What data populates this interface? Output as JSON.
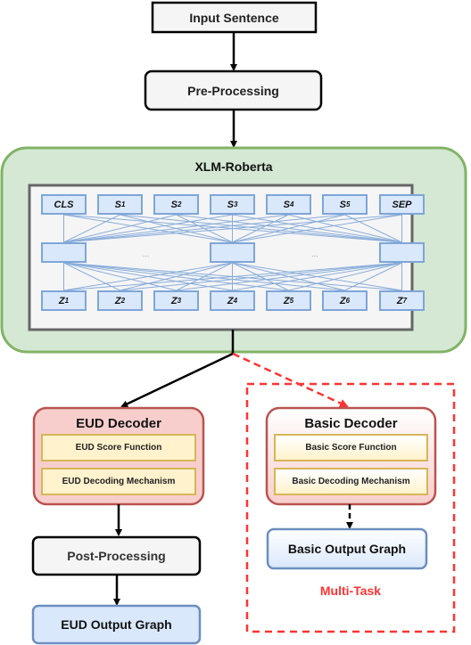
{
  "nodes": {
    "input": "Input Sentence",
    "preprocessing": "Pre-Processing",
    "encoder": "XLM-Roberta",
    "eud_decoder": {
      "title": "EUD Decoder",
      "components": [
        "EUD Score Function",
        "EUD Decoding Mechanism"
      ]
    },
    "basic_decoder": {
      "title": "Basic Decoder",
      "components": [
        "Basic Score Function",
        "Basic Decoding Mechanism"
      ]
    },
    "postprocessing": "Post-Processing",
    "eud_output": "EUD Output Graph",
    "basic_output": "Basic Output Graph",
    "multitask_label": "Multi-Task"
  },
  "tokens_in": [
    {
      "base": "CLS",
      "sub": ""
    },
    {
      "base": "S",
      "sub": "1"
    },
    {
      "base": "S",
      "sub": "2"
    },
    {
      "base": "S",
      "sub": "3"
    },
    {
      "base": "S",
      "sub": "4"
    },
    {
      "base": "S",
      "sub": "5"
    },
    {
      "base": "SEP",
      "sub": ""
    }
  ],
  "tokens_out": [
    {
      "base": "Z",
      "sub": "1"
    },
    {
      "base": "Z",
      "sub": "2"
    },
    {
      "base": "Z",
      "sub": "3"
    },
    {
      "base": "Z",
      "sub": "4"
    },
    {
      "base": "Z",
      "sub": "5"
    },
    {
      "base": "Z",
      "sub": "6"
    },
    {
      "base": "Z",
      "sub": "7"
    }
  ],
  "ellipsis": "...",
  "colors": {
    "encoder_fill": "#d5e8d4",
    "encoder_border": "#82b366",
    "token_fill": "#dae8fc",
    "token_border": "#7ea6d8",
    "decoder_fill": "#f8cecc",
    "decoder_border": "#b85450",
    "component_fill": "#fff2cc",
    "component_border": "#d6b656",
    "multitask": "#ff3333"
  }
}
